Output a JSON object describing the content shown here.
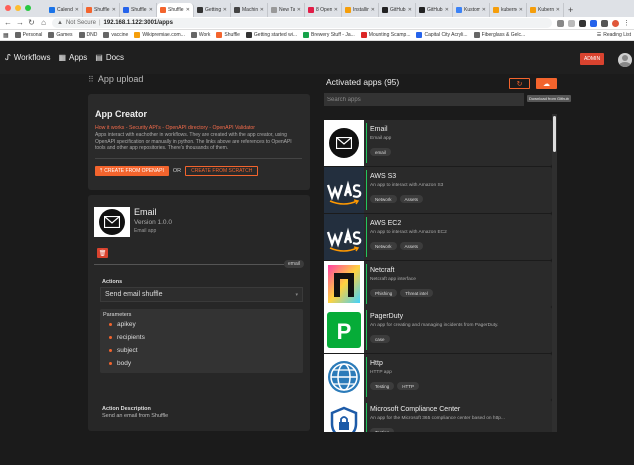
{
  "browser": {
    "tabs": [
      {
        "label": "Calendar",
        "color": "#1a73e8"
      },
      {
        "label": "Shuffle",
        "color": "#f3642d"
      },
      {
        "label": "Shuffle",
        "color": "#2563eb"
      },
      {
        "label": "Shuffle",
        "color": "#f3642d",
        "active": true
      },
      {
        "label": "Getting",
        "color": "#333333"
      },
      {
        "label": "Machine",
        "color": "#444444"
      },
      {
        "label": "New Tab",
        "color": "#999999"
      },
      {
        "label": "8 Open",
        "color": "#e11d48"
      },
      {
        "label": "Installin",
        "color": "#f59e0b"
      },
      {
        "label": "GitHub",
        "color": "#222222"
      },
      {
        "label": "GitHub",
        "color": "#222222"
      },
      {
        "label": "Kustom",
        "color": "#3b82f6"
      },
      {
        "label": "kuberne",
        "color": "#f59e0b"
      },
      {
        "label": "Kuberne",
        "color": "#f59e0b"
      }
    ],
    "new_tab": "+",
    "url_warning": "Not Secure",
    "url": "192.168.1.122:3001/apps",
    "bookmarks": [
      {
        "label": "Personal",
        "color": "#666666"
      },
      {
        "label": "Games",
        "color": "#666666"
      },
      {
        "label": "DND",
        "color": "#666666"
      },
      {
        "label": "vaccine",
        "color": "#666666"
      },
      {
        "label": "Wikipremiae.com...",
        "color": "#f59e0b"
      },
      {
        "label": "Work",
        "color": "#666666"
      },
      {
        "label": "Shuffle",
        "color": "#f3642d"
      },
      {
        "label": "Getting started wi...",
        "color": "#333333"
      },
      {
        "label": "Brewery Stuff - Ja...",
        "color": "#16a34a"
      },
      {
        "label": "Mounting Scamp...",
        "color": "#dc2626"
      },
      {
        "label": "Capital City Acryli...",
        "color": "#2563eb"
      },
      {
        "label": "Fiberglass & Gelc...",
        "color": "#666666"
      }
    ],
    "reading_list": "Reading List"
  },
  "header": {
    "workflows": "Workflows",
    "apps": "Apps",
    "docs": "Docs",
    "admin": "ADMIN"
  },
  "upload": {
    "title": "App upload"
  },
  "creator": {
    "title": "App Creator",
    "links": "How it works - Security API's - OpenAPI directory - OpenAPI Validator",
    "description": "Apps interact with eachother in workflows. They are created with the app creator, using OpenAPI specification or manually in python. The links above are references to OpenAPI tools and other app repositories. There's thousands of them.",
    "create_openapi": "CREATE FROM OPENAPI",
    "or": "OR",
    "create_scratch": "CREATE FROM SCRATCH"
  },
  "selected_app": {
    "name": "Email",
    "version": "Version 1.0.0",
    "subtitle": "Email app",
    "tag": "email",
    "actions_label": "Actions",
    "action": "Send email shuffle",
    "params_label": "Parameters",
    "params": [
      "apikey",
      "recipients",
      "subject",
      "body"
    ],
    "action_desc_label": "Action Description",
    "action_desc": "Send an email from Shuffle"
  },
  "activated": {
    "title": "Activated apps (95)",
    "tooltip": "Download from Github",
    "search_placeholder": "Search apps",
    "apps": [
      {
        "name": "Email",
        "desc": "Email app",
        "tags": [
          "email"
        ],
        "logo": "email"
      },
      {
        "name": "AWS S3",
        "desc": "An app to interact with Amazon S3",
        "tags": [
          "Network",
          "Assets"
        ],
        "logo": "aws"
      },
      {
        "name": "AWS EC2",
        "desc": "An app to interact with Amazon EC2",
        "tags": [
          "Network",
          "Assets"
        ],
        "logo": "aws"
      },
      {
        "name": "Netcraft",
        "desc": "Netcraft app interface",
        "tags": [
          "Phishing",
          "Threat intel"
        ],
        "logo": "netcraft"
      },
      {
        "name": "PagerDuty",
        "desc": "An app for creating and managing incidents from PagerDuty.",
        "tags": [
          "case"
        ],
        "logo": "pagerduty"
      },
      {
        "name": "Http",
        "desc": "HTTP app",
        "tags": [
          "Testing",
          "HTTP"
        ],
        "logo": "http"
      },
      {
        "name": "Microsoft Compliance Center",
        "desc": "An app for the Microsoft 365 compliance center based on http...",
        "tags": [
          "Testing"
        ],
        "logo": "mscc"
      }
    ]
  }
}
